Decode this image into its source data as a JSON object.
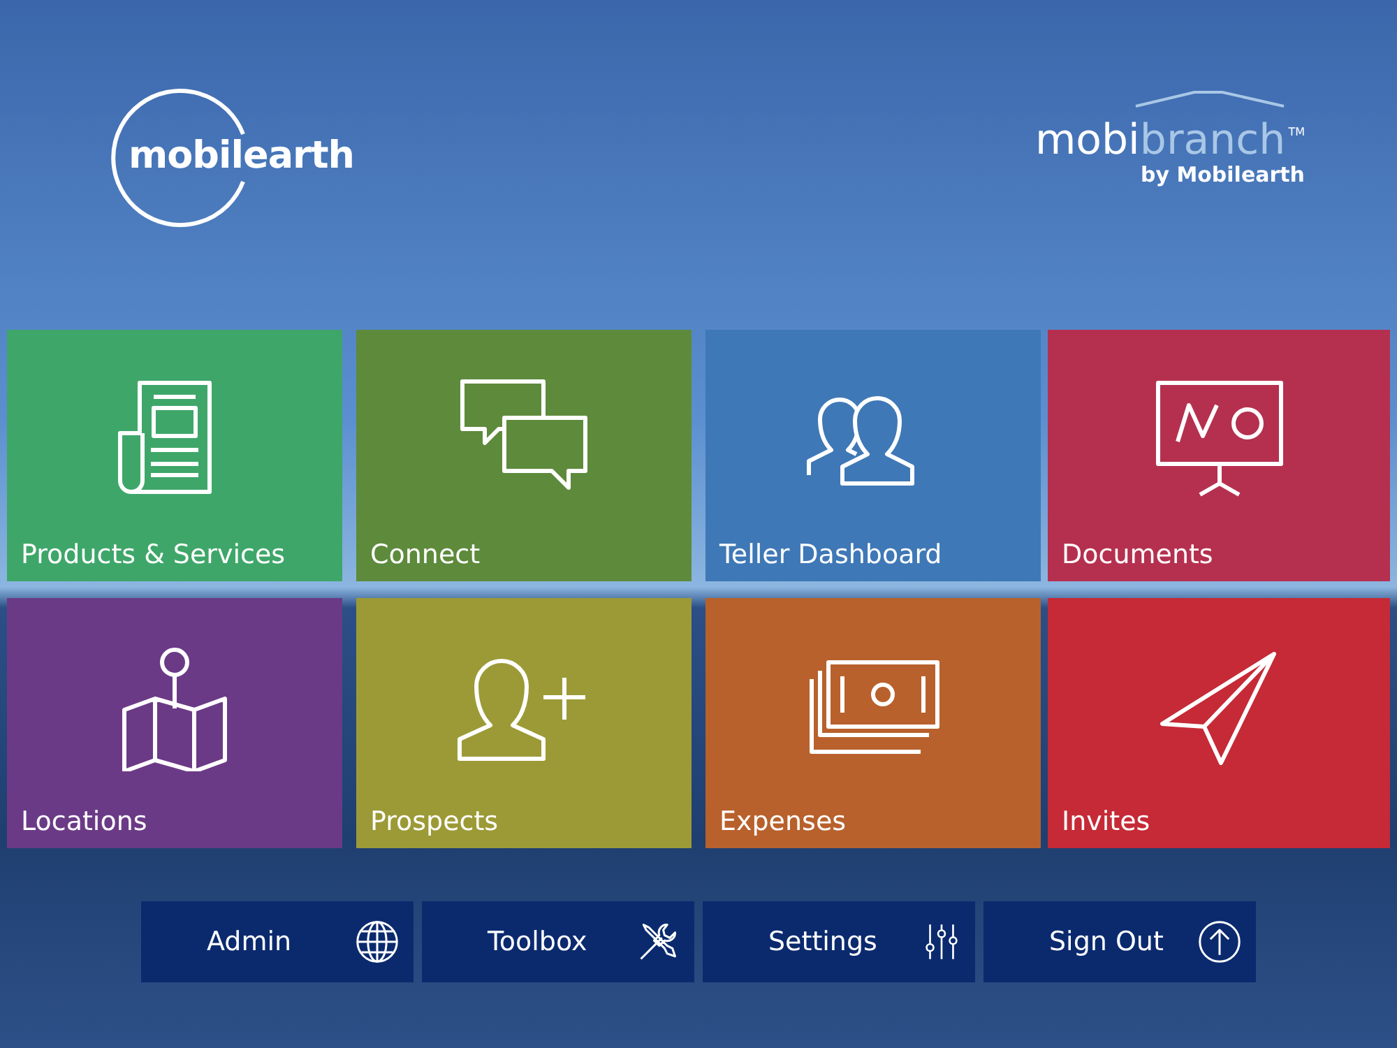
{
  "logo_left": {
    "text": "mobilearth"
  },
  "logo_right": {
    "name_first": "mobi",
    "name_second": "branch",
    "trademark": "TM",
    "tagline": "by Mobilearth"
  },
  "tiles": [
    {
      "label": "Products & Services",
      "color": "#3fa66a"
    },
    {
      "label": "Connect",
      "color": "#5e8a3c"
    },
    {
      "label": "Teller Dashboard",
      "color": "#3f78b6"
    },
    {
      "label": "Documents",
      "color": "#b5304f"
    },
    {
      "label": "Locations",
      "color": "#6b3a86"
    },
    {
      "label": "Prospects",
      "color": "#9c9a36"
    },
    {
      "label": "Expenses",
      "color": "#b8612c"
    },
    {
      "label": "Invites",
      "color": "#c52a36"
    }
  ],
  "buttons": [
    {
      "label": "Admin"
    },
    {
      "label": "Toolbox"
    },
    {
      "label": "Settings"
    },
    {
      "label": "Sign Out"
    }
  ]
}
